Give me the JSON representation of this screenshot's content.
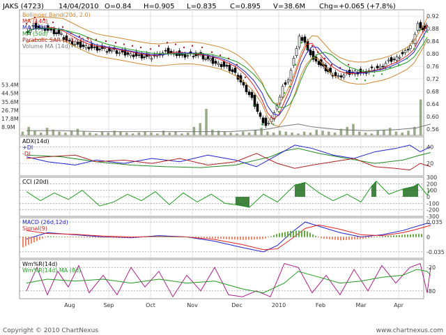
{
  "header": {
    "symbol": "JAKS (4723)",
    "date": "14/04/2010",
    "open": "O=0.84",
    "high": "H=0.905",
    "low": "L=0.835",
    "close": "C=0.895",
    "volume": "V=38.6M",
    "change": "Chg=+0.065 (+7.8%)"
  },
  "footer": {
    "copyright": "Copyright © 2010 ChartNexus",
    "website": "www.chartnexus.com"
  },
  "colors": {
    "frame": "#999999",
    "grid": "#cfcfcf",
    "candle": "#000000",
    "ma14": "#dd2222",
    "ma25": "#2222cc",
    "ma50": "#229922",
    "bollinger": "#cc8833",
    "sar": "#aa2222",
    "sar_up": "#22aa22",
    "volume": "#99aa88",
    "volume_ma": "#777777",
    "adx": "#228822",
    "plus_di": "#2222cc",
    "minus_di": "#aa2222",
    "cci": "#229922",
    "macd": "#2222cc",
    "signal": "#dd2222",
    "wmr": "#aa2288",
    "wmr_ma": "#229922"
  },
  "chart_data": [
    {
      "panel": "price",
      "type": "candlestick",
      "legend": [
        "Bollinger Band(20d, 2.0)",
        "MA (14d)",
        "MA (25d)",
        "MA (50d)",
        "Parabolic SAR (0.02, 0.2)",
        "Volume MA (14d)"
      ],
      "y_ticks": [
        "0.92",
        "0.88",
        "0.84",
        "0.80",
        "0.76",
        "0.72",
        "0.68",
        "0.64",
        "0.60",
        "0.56"
      ],
      "ylim": [
        0.54,
        0.94
      ],
      "x_ticks": [
        "Aug",
        "Sep",
        "Oct",
        "Nov",
        "Dec",
        "2010",
        "Feb",
        "Mar",
        "Apr"
      ],
      "close_path": [
        [
          0.87,
          10
        ],
        [
          0.89,
          22
        ],
        [
          0.885,
          35
        ],
        [
          0.875,
          48
        ],
        [
          0.86,
          62
        ],
        [
          0.84,
          74
        ],
        [
          0.83,
          86
        ],
        [
          0.825,
          98
        ],
        [
          0.82,
          110
        ],
        [
          0.815,
          124
        ],
        [
          0.81,
          138
        ],
        [
          0.805,
          150
        ],
        [
          0.8,
          162
        ],
        [
          0.795,
          174
        ],
        [
          0.79,
          188
        ],
        [
          0.8,
          200
        ],
        [
          0.81,
          212
        ],
        [
          0.805,
          224
        ],
        [
          0.795,
          236
        ],
        [
          0.8,
          248
        ],
        [
          0.795,
          262
        ],
        [
          0.78,
          276
        ],
        [
          0.77,
          288
        ],
        [
          0.76,
          300
        ],
        [
          0.74,
          312
        ],
        [
          0.7,
          324
        ],
        [
          0.66,
          336
        ],
        [
          0.6,
          348
        ],
        [
          0.575,
          356
        ],
        [
          0.6,
          364
        ],
        [
          0.64,
          372
        ],
        [
          0.7,
          380
        ],
        [
          0.72,
          388
        ],
        [
          0.79,
          396
        ],
        [
          0.86,
          404
        ],
        [
          0.84,
          412
        ],
        [
          0.8,
          420
        ],
        [
          0.78,
          428
        ],
        [
          0.76,
          438
        ],
        [
          0.74,
          448
        ],
        [
          0.73,
          460
        ],
        [
          0.74,
          472
        ],
        [
          0.745,
          484
        ],
        [
          0.74,
          496
        ],
        [
          0.755,
          508
        ],
        [
          0.76,
          520
        ],
        [
          0.78,
          532
        ],
        [
          0.79,
          544
        ],
        [
          0.81,
          556
        ],
        [
          0.84,
          566
        ],
        [
          0.9,
          574
        ],
        [
          0.88,
          580
        ],
        [
          0.895,
          585
        ]
      ]
    },
    {
      "panel": "volume",
      "type": "bar",
      "y_ticks": [
        "53.4M",
        "44.5M",
        "35.6M",
        "26.7M",
        "17.8M",
        "8.9M"
      ],
      "ylim": [
        0,
        62.0
      ],
      "values": [
        4,
        9,
        5,
        3,
        8,
        6,
        4,
        3,
        5,
        7,
        4,
        3,
        2,
        4,
        3,
        5,
        4,
        3,
        2,
        3,
        4,
        3,
        2,
        5,
        3,
        4,
        2,
        3,
        9,
        13,
        28,
        6,
        5,
        4,
        3,
        2,
        4,
        3,
        6,
        8,
        4,
        3,
        5,
        4,
        3,
        2,
        4,
        3,
        6,
        5,
        4,
        3,
        7,
        9,
        12,
        4,
        3,
        2,
        5,
        6,
        8,
        4,
        3,
        5,
        9,
        38
      ],
      "ma_path": [
        [
          5,
          10
        ],
        [
          5,
          60
        ],
        [
          4,
          110
        ],
        [
          4,
          160
        ],
        [
          4,
          210
        ],
        [
          4,
          260
        ],
        [
          4,
          300
        ],
        [
          6,
          350
        ],
        [
          10,
          380
        ],
        [
          12,
          400
        ],
        [
          9,
          420
        ],
        [
          6,
          460
        ],
        [
          5,
          500
        ],
        [
          6,
          540
        ],
        [
          8,
          570
        ],
        [
          12,
          590
        ]
      ]
    },
    {
      "panel": "adx",
      "type": "line",
      "legend": [
        "ADX(14d)",
        "+DI",
        "-DI"
      ],
      "y_ticks": [
        "40",
        "20"
      ],
      "ylim": [
        5,
        52
      ],
      "series": [
        {
          "name": "ADX(14d)",
          "values": [
            [
              30,
              10
            ],
            [
              28,
              60
            ],
            [
              22,
              110
            ],
            [
              18,
              160
            ],
            [
              16,
              210
            ],
            [
              15,
              260
            ],
            [
              18,
              310
            ],
            [
              28,
              360
            ],
            [
              35,
              380
            ],
            [
              38,
              400
            ],
            [
              32,
              430
            ],
            [
              26,
              470
            ],
            [
              20,
              510
            ],
            [
              24,
              550
            ],
            [
              30,
              575
            ],
            [
              33,
              590
            ]
          ]
        },
        {
          "name": "+DI",
          "values": [
            [
              28,
              10
            ],
            [
              22,
              40
            ],
            [
              18,
              80
            ],
            [
              24,
              110
            ],
            [
              20,
              150
            ],
            [
              26,
              190
            ],
            [
              22,
              230
            ],
            [
              30,
              270
            ],
            [
              24,
              310
            ],
            [
              16,
              340
            ],
            [
              30,
              370
            ],
            [
              42,
              395
            ],
            [
              38,
              420
            ],
            [
              30,
              450
            ],
            [
              26,
              480
            ],
            [
              34,
              510
            ],
            [
              38,
              540
            ],
            [
              42,
              560
            ],
            [
              34,
              575
            ],
            [
              40,
              590
            ]
          ]
        },
        {
          "name": "-DI",
          "values": [
            [
              26,
              10
            ],
            [
              28,
              40
            ],
            [
              30,
              80
            ],
            [
              22,
              110
            ],
            [
              24,
              150
            ],
            [
              20,
              190
            ],
            [
              26,
              230
            ],
            [
              18,
              270
            ],
            [
              22,
              310
            ],
            [
              32,
              340
            ],
            [
              20,
              370
            ],
            [
              14,
              395
            ],
            [
              18,
              420
            ],
            [
              22,
              450
            ],
            [
              26,
              480
            ],
            [
              16,
              510
            ],
            [
              14,
              540
            ],
            [
              12,
              560
            ],
            [
              20,
              575
            ],
            [
              16,
              590
            ]
          ]
        }
      ]
    },
    {
      "panel": "cci",
      "type": "line",
      "legend": [
        "CCI (20d)"
      ],
      "y_ticks": [
        "300",
        "200",
        "100",
        "0",
        "-100",
        "-200",
        "-300"
      ],
      "ylim": [
        -300,
        300
      ],
      "values": [
        [
          80,
          10
        ],
        [
          -60,
          30
        ],
        [
          60,
          50
        ],
        [
          -40,
          70
        ],
        [
          100,
          90
        ],
        [
          -140,
          115
        ],
        [
          -80,
          135
        ],
        [
          40,
          155
        ],
        [
          -60,
          175
        ],
        [
          80,
          195
        ],
        [
          -120,
          215
        ],
        [
          60,
          235
        ],
        [
          -80,
          255
        ],
        [
          40,
          275
        ],
        [
          -100,
          295
        ],
        [
          -120,
          310
        ],
        [
          -160,
          330
        ],
        [
          40,
          350
        ],
        [
          -80,
          370
        ],
        [
          180,
          395
        ],
        [
          220,
          410
        ],
        [
          60,
          430
        ],
        [
          -60,
          450
        ],
        [
          40,
          470
        ],
        [
          -80,
          490
        ],
        [
          160,
          505
        ],
        [
          240,
          512
        ],
        [
          40,
          530
        ],
        [
          120,
          550
        ],
        [
          160,
          566
        ],
        [
          200,
          572
        ],
        [
          30,
          585
        ],
        [
          120,
          590
        ]
      ]
    },
    {
      "panel": "macd",
      "type": "line",
      "legend": [
        "MACD (26d,12d)",
        "Signal(9)"
      ],
      "y_ticks": [
        "0.035",
        "0",
        "-0.035"
      ],
      "ylim": [
        -0.05,
        0.045
      ],
      "series": [
        {
          "name": "MACD (26d,12d)",
          "values": [
            [
              -0.005,
              10
            ],
            [
              0.01,
              40
            ],
            [
              0.005,
              80
            ],
            [
              0.0,
              120
            ],
            [
              -0.002,
              160
            ],
            [
              0.003,
              200
            ],
            [
              0.0,
              240
            ],
            [
              -0.01,
              280
            ],
            [
              -0.025,
              320
            ],
            [
              -0.035,
              350
            ],
            [
              -0.02,
              370
            ],
            [
              0.01,
              390
            ],
            [
              0.035,
              410
            ],
            [
              0.025,
              430
            ],
            [
              0.01,
              460
            ],
            [
              0.0,
              490
            ],
            [
              0.005,
              520
            ],
            [
              0.015,
              550
            ],
            [
              0.025,
              570
            ],
            [
              0.032,
              585
            ],
            [
              0.03,
              590
            ]
          ]
        },
        {
          "name": "Signal(9)",
          "values": [
            [
              0.015,
              10
            ],
            [
              0.008,
              40
            ],
            [
              0.006,
              80
            ],
            [
              0.002,
              120
            ],
            [
              0.0,
              160
            ],
            [
              0.001,
              200
            ],
            [
              0.0,
              240
            ],
            [
              -0.006,
              280
            ],
            [
              -0.018,
              320
            ],
            [
              -0.03,
              350
            ],
            [
              -0.028,
              370
            ],
            [
              -0.005,
              390
            ],
            [
              0.02,
              410
            ],
            [
              0.028,
              430
            ],
            [
              0.018,
              460
            ],
            [
              0.005,
              490
            ],
            [
              0.003,
              520
            ],
            [
              0.01,
              550
            ],
            [
              0.018,
              570
            ],
            [
              0.025,
              585
            ],
            [
              0.027,
              590
            ]
          ]
        }
      ]
    },
    {
      "panel": "williams",
      "type": "line",
      "legend": [
        "Wm%R(14d)",
        "Wm%R(14d) MA (8d)"
      ],
      "y_ticks": [
        "-20",
        "-80"
      ],
      "ylim": [
        -100,
        0
      ],
      "series": [
        {
          "name": "Wm%R(14d)",
          "values": [
            [
              -80,
              10
            ],
            [
              -20,
              25
            ],
            [
              -90,
              40
            ],
            [
              -30,
              55
            ],
            [
              -70,
              70
            ],
            [
              -15,
              85
            ],
            [
              -85,
              100
            ],
            [
              -40,
              120
            ],
            [
              -90,
              140
            ],
            [
              -20,
              160
            ],
            [
              -70,
              180
            ],
            [
              -30,
              200
            ],
            [
              -95,
              220
            ],
            [
              -40,
              240
            ],
            [
              -80,
              260
            ],
            [
              -20,
              280
            ],
            [
              -90,
              300
            ],
            [
              -95,
              320
            ],
            [
              -80,
              340
            ],
            [
              -95,
              360
            ],
            [
              -10,
              380
            ],
            [
              -20,
              400
            ],
            [
              -85,
              420
            ],
            [
              -40,
              440
            ],
            [
              -90,
              460
            ],
            [
              -25,
              480
            ],
            [
              -80,
              500
            ],
            [
              -15,
              520
            ],
            [
              -60,
              540
            ],
            [
              -20,
              560
            ],
            [
              -10,
              575
            ],
            [
              -85,
              585
            ],
            [
              -20,
              590
            ]
          ]
        },
        {
          "name": "Wm%R(14d) MA (8d)",
          "values": [
            [
              -60,
              10
            ],
            [
              -50,
              40
            ],
            [
              -55,
              80
            ],
            [
              -50,
              120
            ],
            [
              -60,
              160
            ],
            [
              -50,
              200
            ],
            [
              -60,
              240
            ],
            [
              -55,
              280
            ],
            [
              -75,
              320
            ],
            [
              -85,
              350
            ],
            [
              -60,
              380
            ],
            [
              -30,
              400
            ],
            [
              -45,
              430
            ],
            [
              -60,
              460
            ],
            [
              -55,
              490
            ],
            [
              -45,
              520
            ],
            [
              -40,
              550
            ],
            [
              -25,
              570
            ],
            [
              -30,
              585
            ],
            [
              -40,
              590
            ]
          ]
        }
      ]
    }
  ]
}
